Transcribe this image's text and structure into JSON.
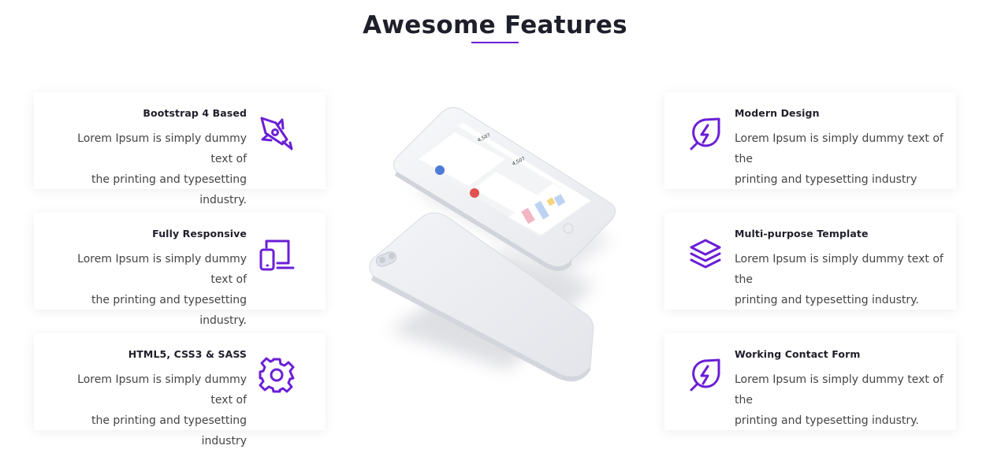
{
  "section": {
    "title": "Awesome Features"
  },
  "features_left": [
    {
      "title": "Bootstrap 4 Based",
      "line1": "Lorem Ipsum is simply dummy text of",
      "line2": "the printing and typesetting industry.",
      "icon": "rocket-icon"
    },
    {
      "title": "Fully Responsive",
      "line1": "Lorem Ipsum is simply dummy text of",
      "line2": "the printing and typesetting industry.",
      "icon": "devices-icon"
    },
    {
      "title": "HTML5, CSS3 & SASS",
      "line1": "Lorem Ipsum is simply dummy text of",
      "line2": "the printing and typesetting industry",
      "icon": "gear-icon"
    }
  ],
  "features_right": [
    {
      "title": "Modern Design",
      "line1": "Lorem Ipsum is simply dummy text of the",
      "line2": "printing and typesetting industry",
      "icon": "leaf-bolt-icon"
    },
    {
      "title": "Multi-purpose Template",
      "line1": "Lorem Ipsum is simply dummy text of the",
      "line2": "printing and typesetting industry.",
      "icon": "layers-icon"
    },
    {
      "title": "Working Contact Form",
      "line1": "Lorem Ipsum is simply dummy text of the",
      "line2": "printing and typesetting industry.",
      "icon": "leaf-bolt-icon"
    }
  ],
  "phone_screen": {
    "stat1": "4,507",
    "stat2": "4,507"
  },
  "colors": {
    "accent": "#6a1fd6",
    "title": "#1f1f2b",
    "body_text": "#444444"
  }
}
